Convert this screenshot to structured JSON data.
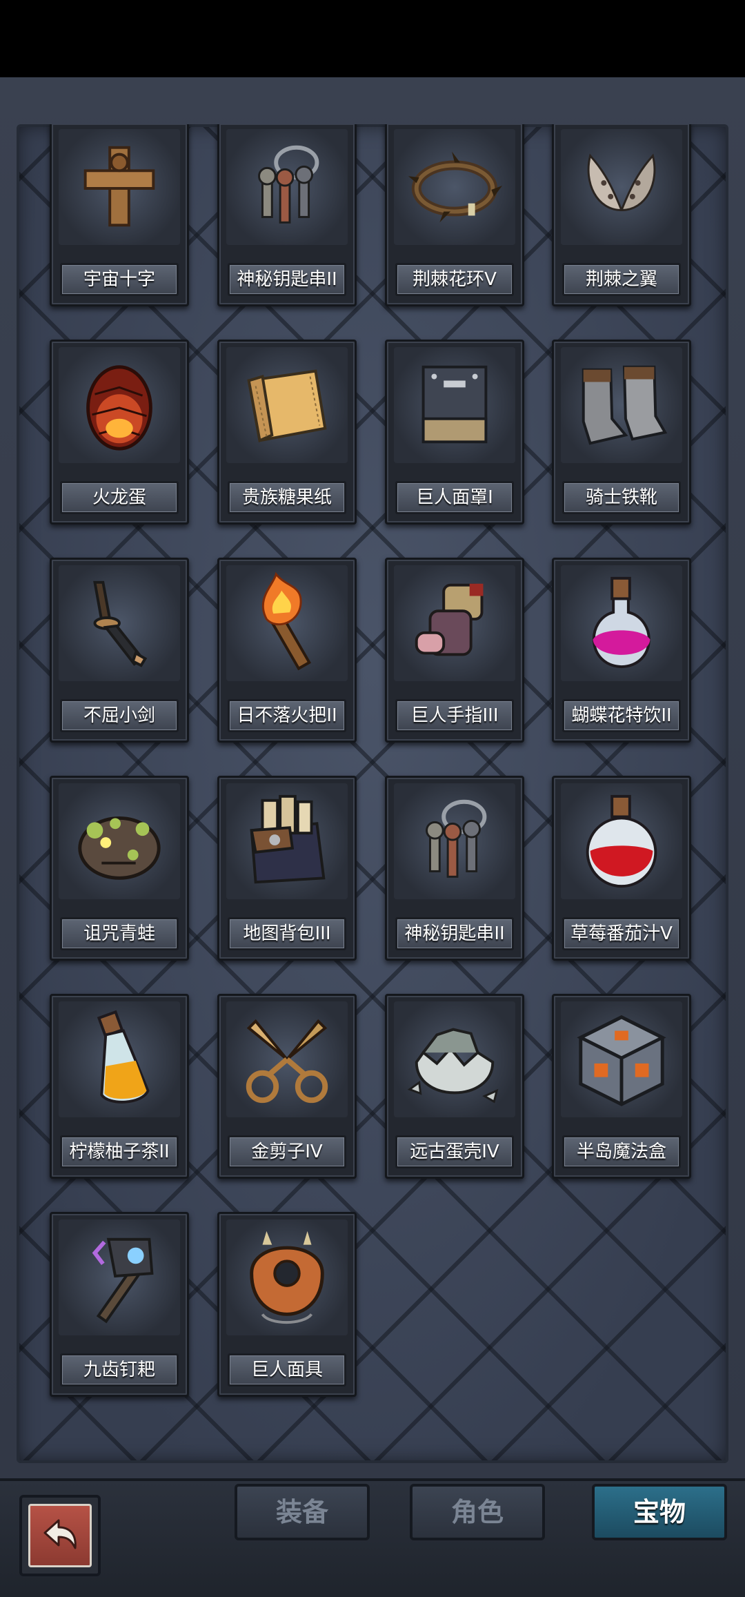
{
  "items": [
    {
      "name": "宇宙十字",
      "icon": "wooden-cross-icon"
    },
    {
      "name": "神秘钥匙串II",
      "icon": "key-ring-icon"
    },
    {
      "name": "荆棘花环V",
      "icon": "thorn-wreath-icon"
    },
    {
      "name": "荆棘之翼",
      "icon": "thorn-wings-icon"
    },
    {
      "name": "火龙蛋",
      "icon": "fire-dragon-egg-icon"
    },
    {
      "name": "贵族糖果纸",
      "icon": "candy-wrapper-icon"
    },
    {
      "name": "巨人面罩I",
      "icon": "giant-mask-armor-icon"
    },
    {
      "name": "骑士铁靴",
      "icon": "knight-boots-icon"
    },
    {
      "name": "不屈小剑",
      "icon": "short-sword-icon"
    },
    {
      "name": "日不落火把II",
      "icon": "torch-icon"
    },
    {
      "name": "巨人手指III",
      "icon": "giant-finger-icon"
    },
    {
      "name": "蝴蝶花特饮II",
      "icon": "purple-potion-icon"
    },
    {
      "name": "诅咒青蛙",
      "icon": "cursed-frog-icon"
    },
    {
      "name": "地图背包III",
      "icon": "map-backpack-icon"
    },
    {
      "name": "神秘钥匙串II",
      "icon": "key-ring-icon"
    },
    {
      "name": "草莓番茄汁V",
      "icon": "red-potion-icon"
    },
    {
      "name": "柠檬柚子茶II",
      "icon": "yellow-potion-icon"
    },
    {
      "name": "金剪子IV",
      "icon": "golden-scissors-icon"
    },
    {
      "name": "远古蛋壳IV",
      "icon": "ancient-eggshell-icon"
    },
    {
      "name": "半岛魔法盒",
      "icon": "magic-cube-icon"
    },
    {
      "name": "九齿钉耙",
      "icon": "nine-tooth-rake-icon"
    },
    {
      "name": "巨人面具",
      "icon": "giant-mask-icon"
    }
  ],
  "tabs": [
    {
      "label": "装备",
      "active": false
    },
    {
      "label": "角色",
      "active": false
    },
    {
      "label": "宝物",
      "active": true
    }
  ],
  "back_icon": "back-arrow-icon",
  "colors": {
    "active_tab": "#2c6f8a",
    "back_button": "#b65246",
    "panel": "#3b4457"
  }
}
